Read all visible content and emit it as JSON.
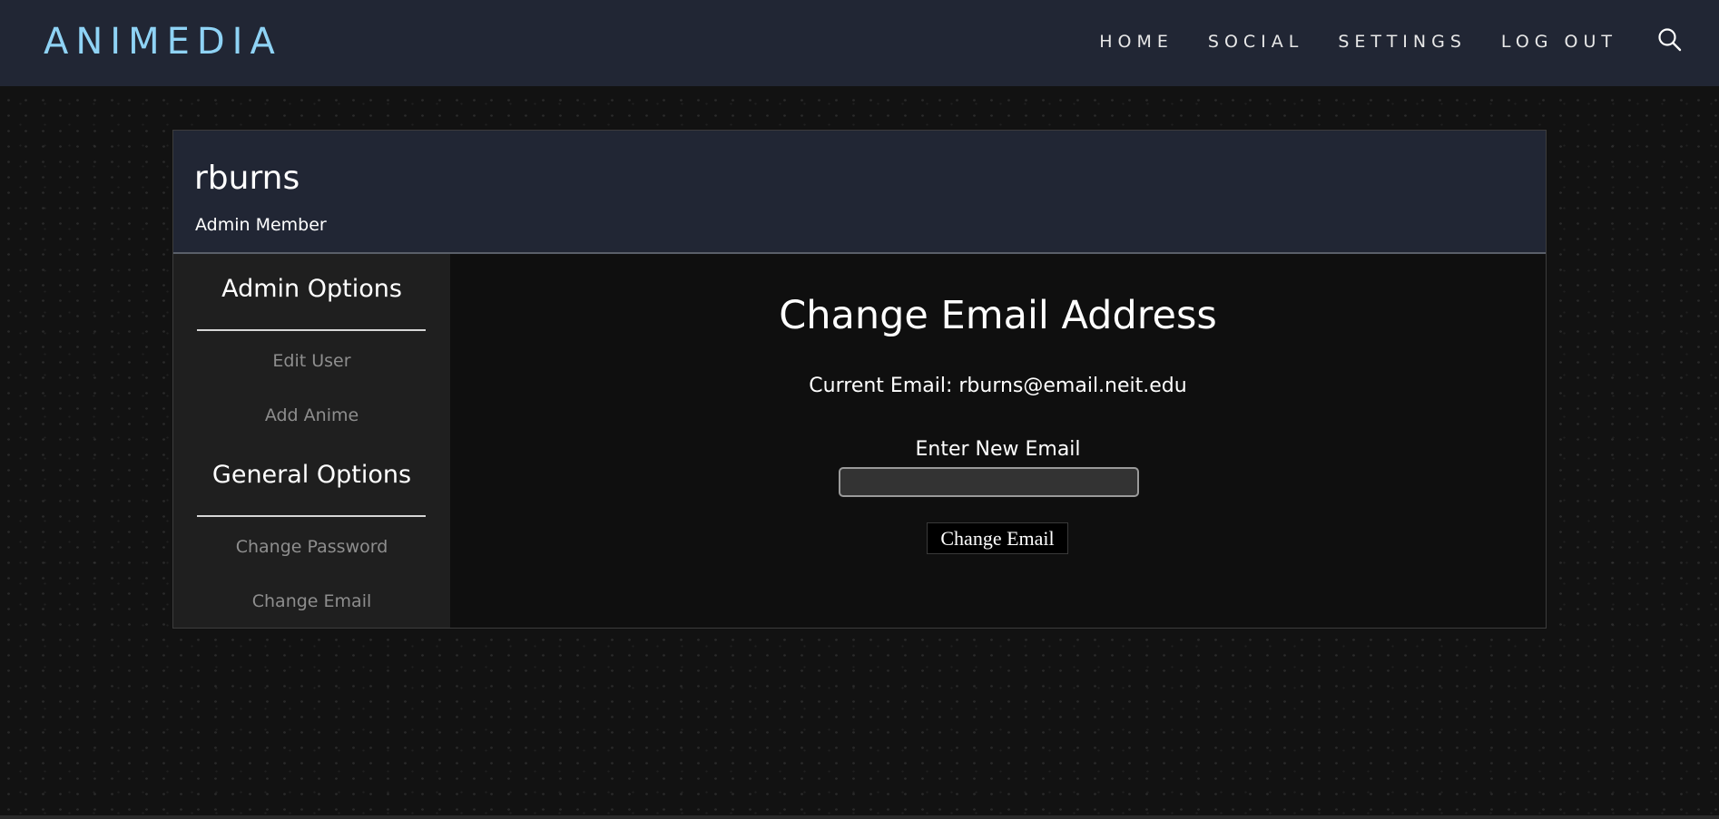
{
  "navbar": {
    "brand": "ANIMEDIA",
    "links": [
      {
        "label": "HOME"
      },
      {
        "label": "SOCIAL"
      },
      {
        "label": "SETTINGS"
      },
      {
        "label": "LOG OUT"
      }
    ],
    "search_icon": "search-icon"
  },
  "profile": {
    "username": "rburns",
    "role": "Admin Member"
  },
  "sidebar": {
    "admin_heading": "Admin Options",
    "admin_items": [
      {
        "label": "Edit User"
      },
      {
        "label": "Add Anime"
      }
    ],
    "general_heading": "General Options",
    "general_items": [
      {
        "label": "Change Password"
      },
      {
        "label": "Change Email"
      }
    ]
  },
  "main": {
    "title": "Change Email Address",
    "current_email": "Current Email: rburns@email.neit.edu",
    "new_email_label": "Enter New Email",
    "new_email_value": "",
    "submit_label": "Change Email"
  },
  "colors": {
    "navbar_bg": "#212634",
    "brand": "#8fd3f5",
    "page_bg": "#121212",
    "sidebar_bg": "#1f1f1f",
    "content_bg": "#0f0f0f",
    "sidebar_link": "#8e8e8e",
    "input_bg": "#333333"
  }
}
